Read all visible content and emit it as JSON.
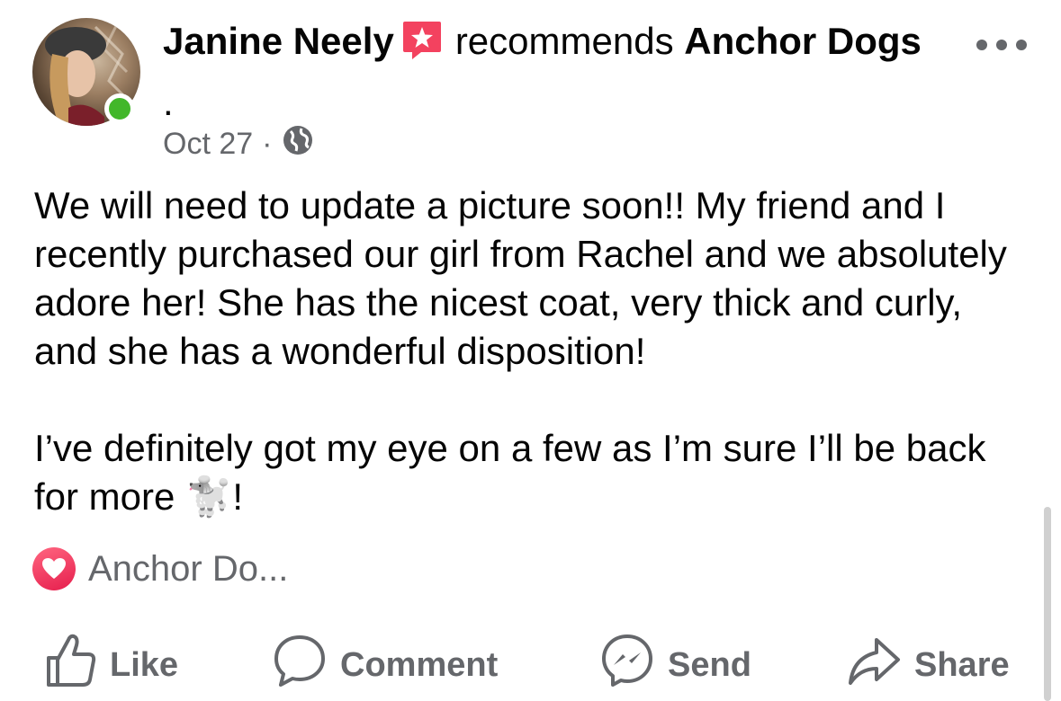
{
  "post": {
    "author": "Janine Neely",
    "recommends_word": "recommends",
    "page_name": "Anchor Dogs",
    "page_name_suffix": " .",
    "date": "Oct 27",
    "dot": "·",
    "privacy_icon": "globe-icon",
    "more_icon": "ellipsis-icon",
    "recommend_badge_icon": "star-speech-bubble-icon",
    "online_color": "#42b72a",
    "paragraphs": [
      "We will need to update a picture soon!! My friend and I recently purchased our girl from Rachel and we absolutely adore her! She has the nicest coat, very thick and curly, and she has a wonderful disposition!",
      "I’ve definitely got my eye on a few as I’m sure I’ll be back for more"
    ],
    "paragraph_end": "!",
    "emoji": "🐩"
  },
  "reactions": {
    "icon": "heart-icon",
    "text": "Anchor Do..."
  },
  "actions": {
    "like": "Like",
    "comment": "Comment",
    "send": "Send",
    "share": "Share"
  },
  "colors": {
    "text": "#050505",
    "secondary": "#65676b",
    "love": "#e61e4d",
    "badge": "#f3425f"
  }
}
